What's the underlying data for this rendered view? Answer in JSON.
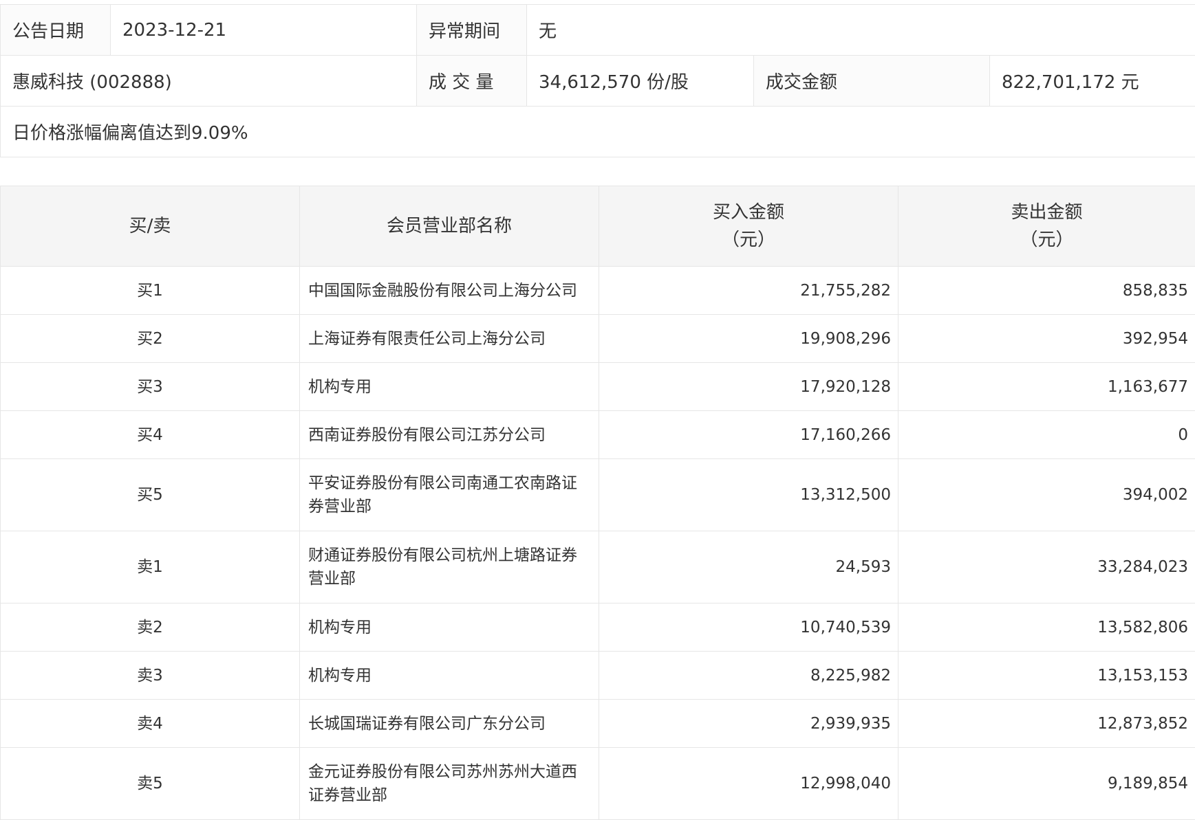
{
  "info": {
    "date_label": "公告日期",
    "date_value": "2023-12-21",
    "period_label": "异常期间",
    "period_value": "无",
    "stock": "惠威科技 (002888)",
    "volume_label": "成 交 量",
    "volume_value": "34,612,570 份/股",
    "amount_label": "成交金额",
    "amount_value": "822,701,172 元",
    "reason": "日价格涨幅偏离值达到9.09%"
  },
  "table": {
    "headers": {
      "side": "买/卖",
      "dept": "会员营业部名称",
      "buy": "买入金额",
      "buy_unit": "（元）",
      "sell": "卖出金额",
      "sell_unit": "（元）"
    },
    "rows": [
      {
        "side": "买1",
        "dept": "中国国际金融股份有限公司上海分公司",
        "buy": "21,755,282",
        "sell": "858,835"
      },
      {
        "side": "买2",
        "dept": "上海证券有限责任公司上海分公司",
        "buy": "19,908,296",
        "sell": "392,954"
      },
      {
        "side": "买3",
        "dept": "机构专用",
        "buy": "17,920,128",
        "sell": "1,163,677"
      },
      {
        "side": "买4",
        "dept": "西南证券股份有限公司江苏分公司",
        "buy": "17,160,266",
        "sell": "0"
      },
      {
        "side": "买5",
        "dept": "平安证券股份有限公司南通工农南路证券营业部",
        "buy": "13,312,500",
        "sell": "394,002"
      },
      {
        "side": "卖1",
        "dept": "财通证券股份有限公司杭州上塘路证券营业部",
        "buy": "24,593",
        "sell": "33,284,023"
      },
      {
        "side": "卖2",
        "dept": "机构专用",
        "buy": "10,740,539",
        "sell": "13,582,806"
      },
      {
        "side": "卖3",
        "dept": "机构专用",
        "buy": "8,225,982",
        "sell": "13,153,153"
      },
      {
        "side": "卖4",
        "dept": "长城国瑞证券有限公司广东分公司",
        "buy": "2,939,935",
        "sell": "12,873,852"
      },
      {
        "side": "卖5",
        "dept": "金元证券股份有限公司苏州苏州大道西证券营业部",
        "buy": "12,998,040",
        "sell": "9,189,854"
      }
    ]
  }
}
